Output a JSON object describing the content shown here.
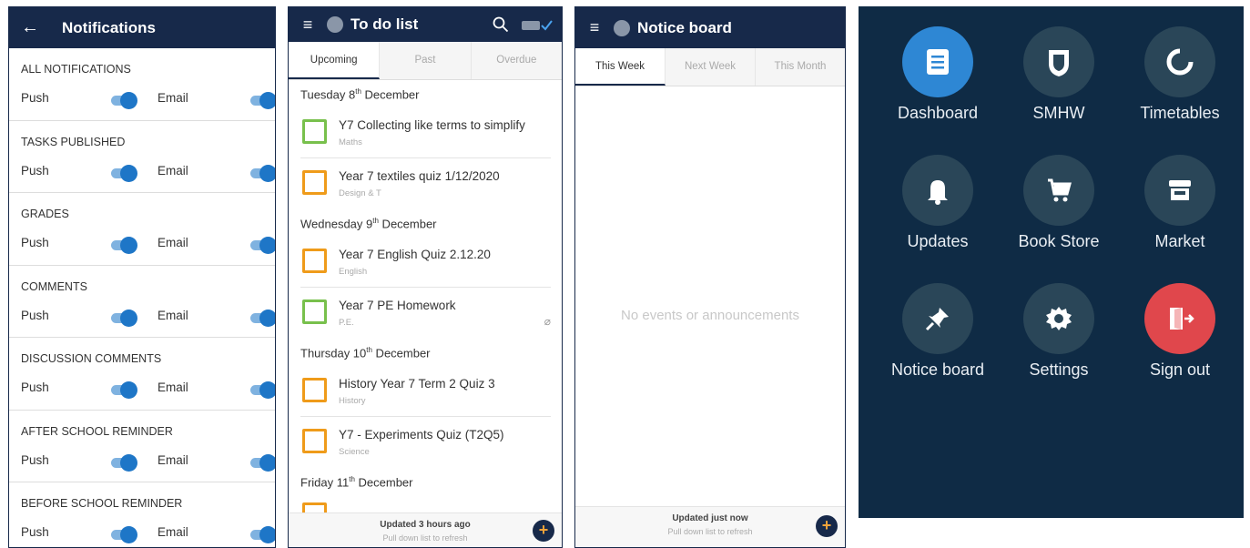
{
  "notifications": {
    "title": "Notifications",
    "sections": [
      {
        "heading": "ALL NOTIFICATIONS",
        "push": "Push",
        "email": "Email"
      },
      {
        "heading": "TASKS PUBLISHED",
        "push": "Push",
        "email": "Email"
      },
      {
        "heading": "GRADES",
        "push": "Push",
        "email": "Email"
      },
      {
        "heading": "COMMENTS",
        "push": "Push",
        "email": "Email"
      },
      {
        "heading": "DISCUSSION COMMENTS",
        "push": "Push",
        "email": "Email"
      },
      {
        "heading": "AFTER SCHOOL REMINDER",
        "push": "Push",
        "email": "Email"
      },
      {
        "heading": "BEFORE SCHOOL REMINDER",
        "push": "Push",
        "email": "Email"
      }
    ]
  },
  "todo": {
    "title": "To do list",
    "tabs": [
      "Upcoming",
      "Past",
      "Overdue"
    ],
    "days": [
      {
        "label": "Tuesday 8",
        "sup": "th",
        "suffix": " December",
        "tasks": [
          {
            "title": "Y7 Collecting like terms to simplify",
            "subject": "Maths"
          },
          {
            "title": "Year 7 textiles quiz 1/12/2020",
            "subject": "Design & T"
          }
        ]
      },
      {
        "label": "Wednesday 9",
        "sup": "th",
        "suffix": " December",
        "tasks": [
          {
            "title": "Year 7 English Quiz 2.12.20",
            "subject": "English"
          },
          {
            "title": "Year 7 PE Homework",
            "subject": "P.E."
          }
        ]
      },
      {
        "label": "Thursday 10",
        "sup": "th",
        "suffix": " December",
        "tasks": [
          {
            "title": "History Year 7 Term 2 Quiz 3",
            "subject": "History"
          },
          {
            "title": "Y7 - Experiments Quiz (T2Q5)",
            "subject": "Science"
          }
        ]
      },
      {
        "label": "Friday 11",
        "sup": "th",
        "suffix": " December",
        "tasks": []
      }
    ],
    "footer": {
      "updated": "Updated 3 hours ago",
      "hint": "Pull down list to refresh"
    }
  },
  "notice": {
    "title": "Notice board",
    "tabs": [
      "This Week",
      "Next Week",
      "This Month"
    ],
    "empty": "No events or announcements",
    "footer": {
      "updated": "Updated just now",
      "hint": "Pull down list to refresh"
    }
  },
  "menu": {
    "tiles": [
      {
        "label": "Dashboard",
        "icon": "dashboard-icon"
      },
      {
        "label": "SMHW",
        "icon": "shield-icon"
      },
      {
        "label": "Timetables",
        "icon": "ring-icon"
      },
      {
        "label": "Updates",
        "icon": "bell-icon"
      },
      {
        "label": "Book Store",
        "icon": "cart-icon"
      },
      {
        "label": "Market",
        "icon": "store-icon"
      },
      {
        "label": "Notice board",
        "icon": "pin-icon"
      },
      {
        "label": "Settings",
        "icon": "gear-icon"
      },
      {
        "label": "Sign out",
        "icon": "exit-icon"
      }
    ]
  },
  "colors": {
    "navy": "#17294a",
    "toggle": "#1e76c7",
    "orange": "#ef9b1a",
    "green": "#78c04c",
    "menu_bg": "#0f2b45",
    "signout": "#e0474c"
  }
}
